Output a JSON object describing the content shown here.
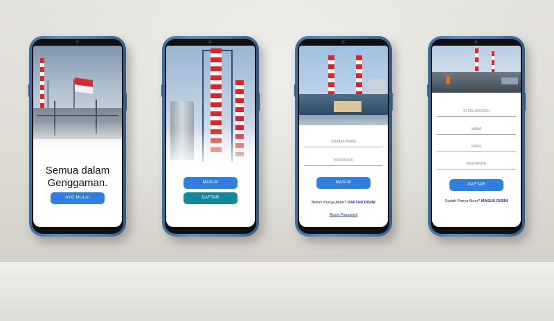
{
  "screens": [
    {
      "title": "Semua dalam Genggaman.",
      "primary_button": "AYO MULAI"
    },
    {
      "login_button": "MASUK",
      "register_button": "DAFTAR"
    },
    {
      "username_placeholder": "ID/EMAIL/NAME",
      "password_placeholder": "PASSWORD",
      "login_button": "MASUK",
      "register_prompt": "Belum Punya Akun?",
      "register_link": "DAFTAR DISINI",
      "reset_link": "Reset Password"
    },
    {
      "customer_id_placeholder": "ID PELANGGAN",
      "name_placeholder": "NAMA",
      "email_placeholder": "EMAIL",
      "password_placeholder": "PASSWORD",
      "register_button": "DAFTAR",
      "login_prompt": "Sudah Punya Akun?",
      "login_link": "MASUK DISINI"
    }
  ],
  "colors": {
    "phone_frame": "#4b7fb0",
    "primary_button": "#2f7fe0",
    "secondary_button": "#15879d",
    "link": "#1b2fb5"
  }
}
